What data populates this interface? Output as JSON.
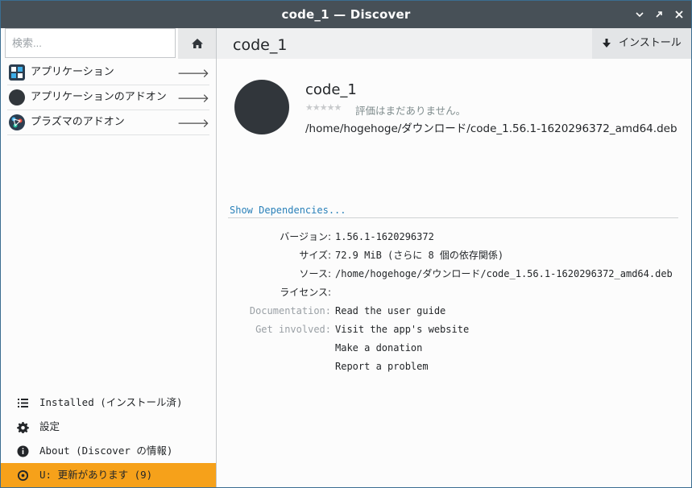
{
  "window": {
    "title": "code_1 — Discover"
  },
  "search": {
    "placeholder": "検索..."
  },
  "categories": [
    {
      "label": "アプリケーション",
      "icon": "applications-icon"
    },
    {
      "label": "アプリケーションのアドオン",
      "icon": "app-addons-icon"
    },
    {
      "label": "プラズマのアドオン",
      "icon": "plasma-addons-icon"
    }
  ],
  "bottom_nav": {
    "installed": "Installed (インストール済)",
    "settings": "設定",
    "about": "About (Discover の情報)",
    "updates": "U: 更新があります (9)"
  },
  "page": {
    "title": "code_1",
    "install_label": "インストール"
  },
  "app": {
    "name": "code_1",
    "stars": "★★★★★",
    "rating_text": "評価はまだありません。",
    "path": "/home/hogehoge/ダウンロード/code_1.56.1-1620296372_amd64.deb"
  },
  "dependencies_link": "Show Dependencies...",
  "details": {
    "version_label": "バージョン:",
    "version_value": "1.56.1-1620296372",
    "size_label": "サイズ:",
    "size_value": "72.9 MiB (さらに 8 個の依存関係)",
    "source_label": "ソース:",
    "source_value": "/home/hogehoge/ダウンロード/code_1.56.1-1620296372_amd64.deb",
    "license_label": "ライセンス:",
    "documentation_label": "Documentation:",
    "documentation_link": "Read the user guide",
    "get_involved_label": "Get involved:",
    "website_link": "Visit the app's website",
    "donation_link": "Make a donation",
    "report_link": "Report a problem"
  },
  "colors": {
    "titlebar": "#475057",
    "accent": "#2980b9",
    "update_highlight": "#f6a11a",
    "app_icon": "#31363b"
  }
}
